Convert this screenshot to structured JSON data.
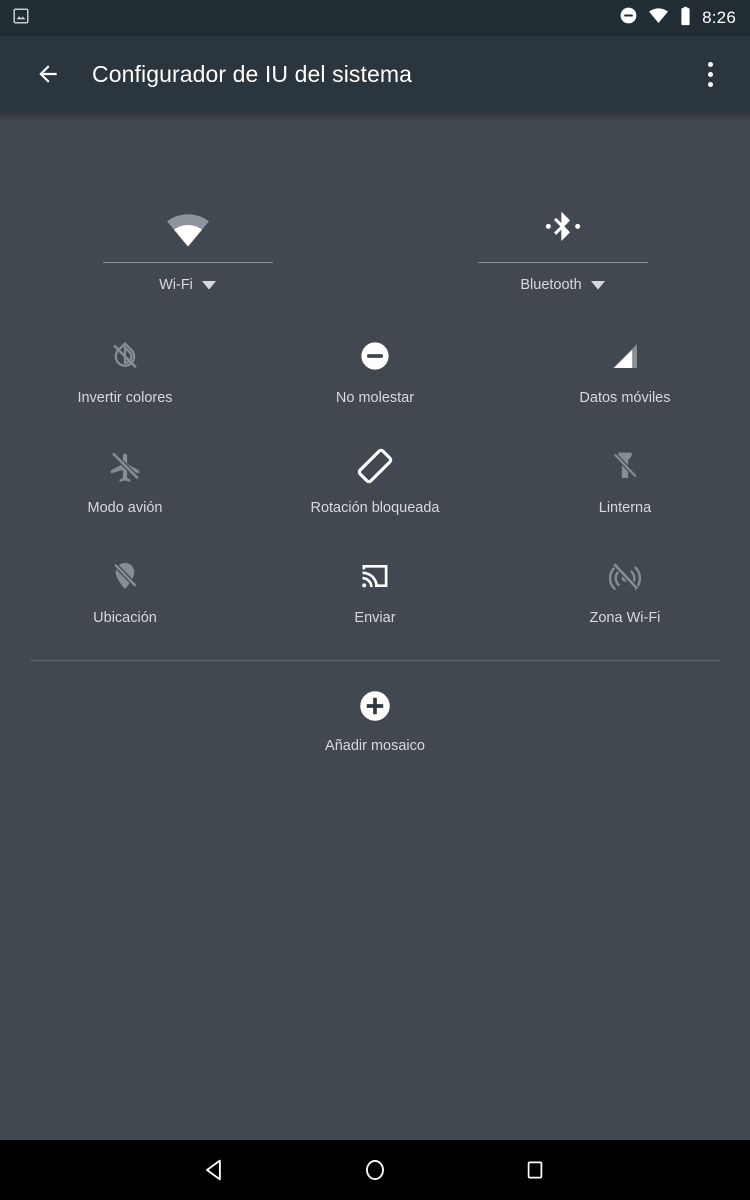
{
  "status_bar": {
    "left_icons": [
      {
        "name": "screenshot-notification-icon",
        "label": "screenshot"
      }
    ],
    "right_icons": [
      {
        "name": "do-not-disturb-icon",
        "label": "do-not-disturb"
      },
      {
        "name": "wifi-icon",
        "label": "wifi"
      },
      {
        "name": "battery-icon",
        "label": "battery-full"
      }
    ],
    "time": "8:26"
  },
  "app_bar": {
    "back_label": "back-arrow",
    "title": "Configurador de IU del sistema",
    "overflow_label": "more-options"
  },
  "quick_settings": {
    "detail_tiles": [
      {
        "label": "Wi-Fi",
        "icon": "wifi-icon",
        "state": "on",
        "has_dropdown": true
      },
      {
        "label": "Bluetooth",
        "icon": "bluetooth-icon",
        "state": "on",
        "has_dropdown": true
      }
    ],
    "tiles": [
      {
        "label": "Invertir colores",
        "icon": "invert-colors-off-icon",
        "state": "off"
      },
      {
        "label": "No molestar",
        "icon": "do-not-disturb-icon",
        "state": "on"
      },
      {
        "label": "Datos móviles",
        "icon": "signal-cellular-icon",
        "state": "on"
      },
      {
        "label": "Modo avión",
        "icon": "airplane-mode-off-icon",
        "state": "off"
      },
      {
        "label": "Rotación bloqueada",
        "icon": "screen-rotation-lock-icon",
        "state": "on"
      },
      {
        "label": "Linterna",
        "icon": "flashlight-off-icon",
        "state": "off"
      },
      {
        "label": "Ubicación",
        "icon": "location-off-icon",
        "state": "off"
      },
      {
        "label": "Enviar",
        "icon": "cast-icon",
        "state": "on"
      },
      {
        "label": "Zona Wi-Fi",
        "icon": "hotspot-off-icon",
        "state": "off"
      }
    ],
    "add_tile": {
      "label": "Añadir mosaico",
      "icon": "plus-icon"
    }
  },
  "nav_bar": {
    "buttons": [
      {
        "name": "back",
        "icon": "triangle-back-icon"
      },
      {
        "name": "home",
        "icon": "circle-home-icon"
      },
      {
        "name": "recents",
        "icon": "square-recents-icon"
      }
    ]
  },
  "colors": {
    "status_bar_bg": "#222c33",
    "app_bar_bg": "#2b353d",
    "content_bg": "#424850",
    "nav_bar_bg": "#000000",
    "label_text": "#d6d9dc",
    "icon_on": "#ffffff",
    "icon_off": "#868d95",
    "divider": "#5c636b"
  }
}
